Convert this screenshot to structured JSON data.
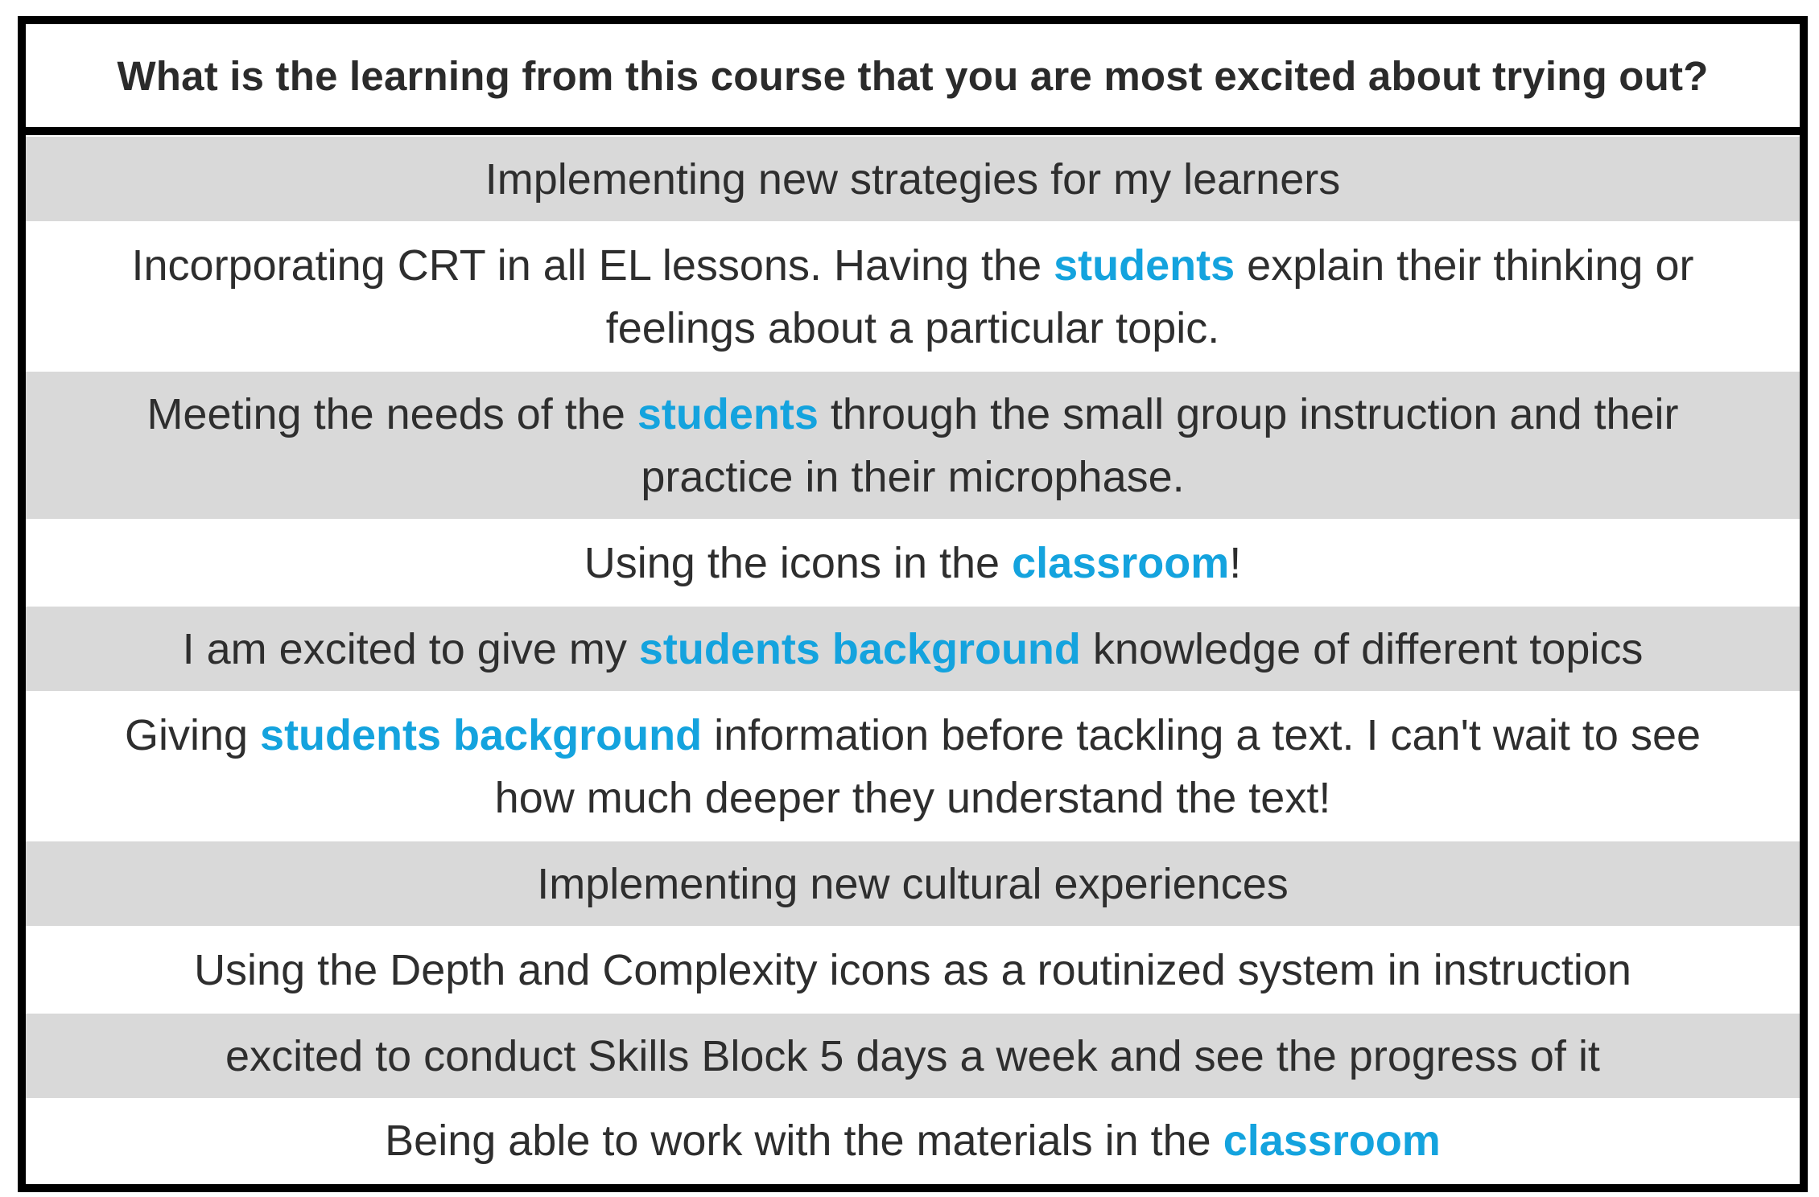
{
  "question": "What is the learning from this course that you are most excited about trying out?",
  "accent_color": "#14a3de",
  "rows": [
    {
      "parts": [
        {
          "text": "Implementing new strategies for my learners",
          "hl": false
        }
      ]
    },
    {
      "parts": [
        {
          "text": "Incorporating CRT in all EL lessons. Having the ",
          "hl": false
        },
        {
          "text": "students",
          "hl": true
        },
        {
          "text": " explain their thinking or feelings about a particular topic.",
          "hl": false
        }
      ]
    },
    {
      "parts": [
        {
          "text": "Meeting the needs of the ",
          "hl": false
        },
        {
          "text": "students",
          "hl": true
        },
        {
          "text": " through the small group instruction and their practice in their microphase.",
          "hl": false
        }
      ]
    },
    {
      "parts": [
        {
          "text": "Using the icons in the ",
          "hl": false
        },
        {
          "text": "classroom",
          "hl": true
        },
        {
          "text": "!",
          "hl": false
        }
      ]
    },
    {
      "parts": [
        {
          "text": "I am excited to give my ",
          "hl": false
        },
        {
          "text": "students background",
          "hl": true
        },
        {
          "text": " knowledge of different topics",
          "hl": false
        }
      ]
    },
    {
      "parts": [
        {
          "text": "Giving ",
          "hl": false
        },
        {
          "text": "students background",
          "hl": true
        },
        {
          "text": " information before tackling a text. I can't wait to see how much deeper they understand the text!",
          "hl": false
        }
      ]
    },
    {
      "parts": [
        {
          "text": "Implementing new cultural experiences",
          "hl": false
        }
      ]
    },
    {
      "parts": [
        {
          "text": "Using the Depth and Complexity icons as a routinized system in instruction",
          "hl": false
        }
      ]
    },
    {
      "parts": [
        {
          "text": "excited to conduct Skills Block 5 days a week and see the progress of it",
          "hl": false
        }
      ]
    },
    {
      "parts": [
        {
          "text": "Being able to work with the materials in the ",
          "hl": false
        },
        {
          "text": "classroom",
          "hl": true
        }
      ]
    }
  ]
}
